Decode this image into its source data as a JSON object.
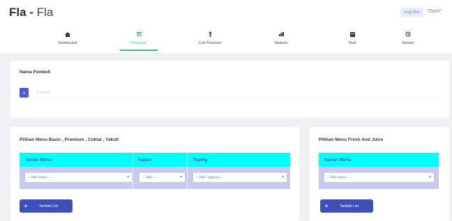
{
  "header": {
    "brand_bold": "Fla",
    "brand_sep": " - ",
    "brand_light": "Fla",
    "logout_label": "Log Out",
    "user_label": "\"Oyen\""
  },
  "nav": {
    "items": [
      {
        "label": "Dashboard",
        "icon": "home-icon"
      },
      {
        "label": "Pesanan",
        "icon": "order-icon",
        "active": true
      },
      {
        "label": "Cek Pesanan",
        "icon": "check-order-icon"
      },
      {
        "label": "Statistic",
        "icon": "chart-icon"
      },
      {
        "label": "Stok",
        "icon": "stock-icon"
      },
      {
        "label": "History",
        "icon": "history-icon"
      }
    ],
    "accent_color": "#3bbf8a"
  },
  "pembeli": {
    "title": "Nama Pembeli",
    "add_label": "+",
    "input_placeholder": "Pembeli"
  },
  "basic": {
    "title": "Pilihan Menu Basic , Premium , Coklat , Yakult",
    "columns": [
      "Varian Menu",
      "Sajian",
      "Toping"
    ],
    "selects": [
      "-- Pilih Menu --",
      "-- Pilih --",
      "-- Pilih Topping --"
    ],
    "button_label": "Tambah List"
  },
  "fresh": {
    "title": "Pilihan Menu Fresh And Juice",
    "columns": [
      "Varian Menu"
    ],
    "selects": [
      "-- Pilih Menu --"
    ],
    "button_label": "Tambah List"
  },
  "colors": {
    "table_header": "#00ffff",
    "table_body": "#c7c9f0",
    "primary": "#4b5bd4"
  }
}
